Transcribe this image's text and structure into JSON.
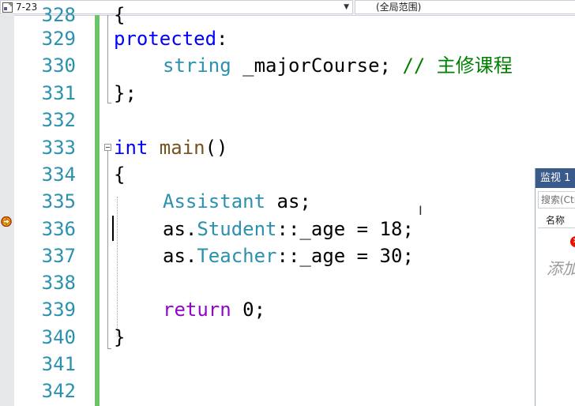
{
  "nav": {
    "scope_left": "7-23",
    "scope_right": "(全局范围)"
  },
  "editor": {
    "line_numbers": [
      "328",
      "329",
      "330",
      "331",
      "332",
      "333",
      "334",
      "335",
      "336",
      "337",
      "338",
      "339",
      "340",
      "341",
      "342"
    ],
    "code": {
      "l328": "{",
      "l329_kw": "protected",
      "l329_rest": ":",
      "l330_type": "string",
      "l330_ident": " _majorCourse; ",
      "l330_comment": "// 主修课程",
      "l331": "};",
      "l333_kw": "int",
      "l333_fn": " main",
      "l333_rest": "()",
      "l334": "{",
      "l335_type": "Assistant",
      "l335_rest": " as;",
      "l336_a": "as.",
      "l336_type": "Student",
      "l336_rest": "::_age = 18;",
      "l337_a": "as.",
      "l337_type": "Teacher",
      "l337_rest": "::_age = 30;",
      "l339_kw": "return",
      "l339_rest": " 0;",
      "l340": "}"
    },
    "colors": {
      "keyword": "#0000ff",
      "type": "#2b91af",
      "comment": "#008000",
      "return_keyword": "#8f08c4",
      "line_number": "#2b91af",
      "change_bar": "#6cc36c"
    }
  },
  "watch": {
    "title": "监视 1",
    "search_placeholder": "搜索(Ctrl+E)",
    "column_name": "名称",
    "add_hint": "添加要监视的项"
  }
}
